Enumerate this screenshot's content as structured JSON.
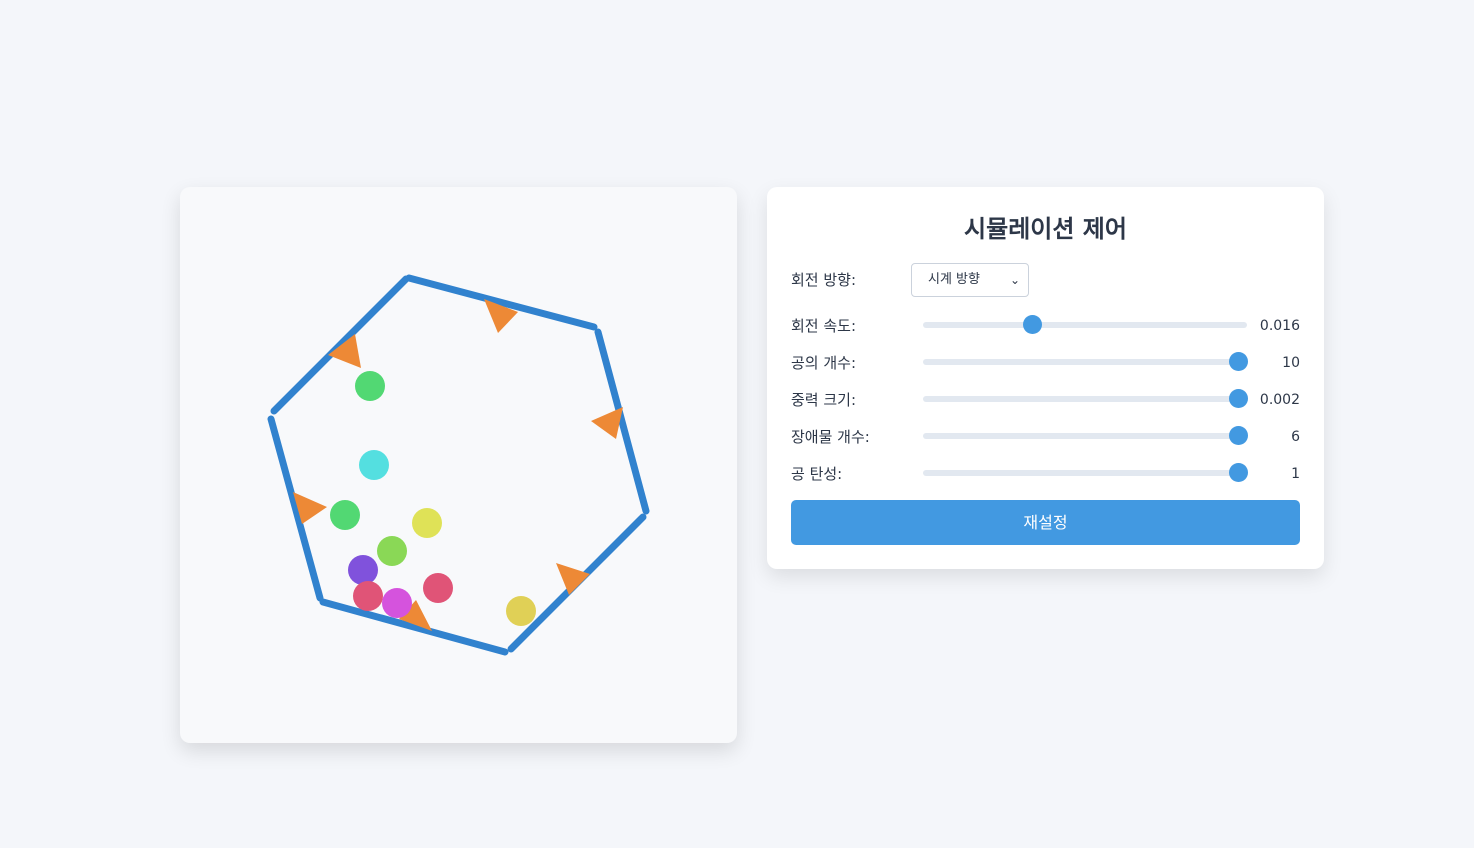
{
  "panel": {
    "title": "시뮬레이션 제어",
    "direction": {
      "label": "회전 방향:",
      "selected": "시계 방향"
    },
    "sliders": [
      {
        "label": "회전 속도:",
        "value": "0.016",
        "fraction": 0.33
      },
      {
        "label": "공의 개수:",
        "value": "10",
        "fraction": 1.0
      },
      {
        "label": "중력 크기:",
        "value": "0.002",
        "fraction": 1.0
      },
      {
        "label": "장애물 개수:",
        "value": "6",
        "fraction": 1.0
      },
      {
        "label": "공 탄성:",
        "value": "1",
        "fraction": 1.0
      }
    ],
    "reset_label": "재설정"
  },
  "colors": {
    "accent": "#4299e1",
    "hexagon": "#3182ce",
    "obstacle": "#ed8936"
  }
}
